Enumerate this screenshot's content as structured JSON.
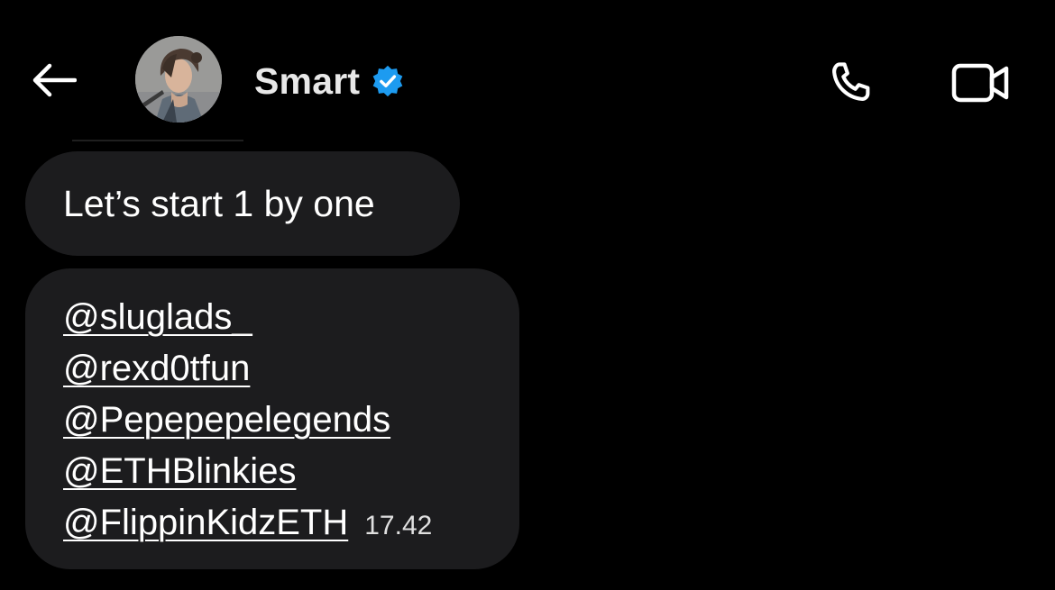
{
  "header": {
    "back_icon": "arrow-left-icon",
    "contact_name": "Smart",
    "verified_icon": "verified-badge-icon",
    "call_icon": "phone-icon",
    "video_icon": "video-camera-icon"
  },
  "colors": {
    "background": "#000000",
    "bubble": "#1c1c1e",
    "verified_badge": "#1d9bf0",
    "text": "#ffffff"
  },
  "messages": [
    {
      "text": "Let’s start 1 by one"
    },
    {
      "mentions": [
        "@sluglads_",
        "@rexd0tfun",
        "@Pepepepelegends",
        "@ETHBlinkies",
        "@FlippinKidzETH"
      ],
      "timestamp": "17.42"
    }
  ]
}
